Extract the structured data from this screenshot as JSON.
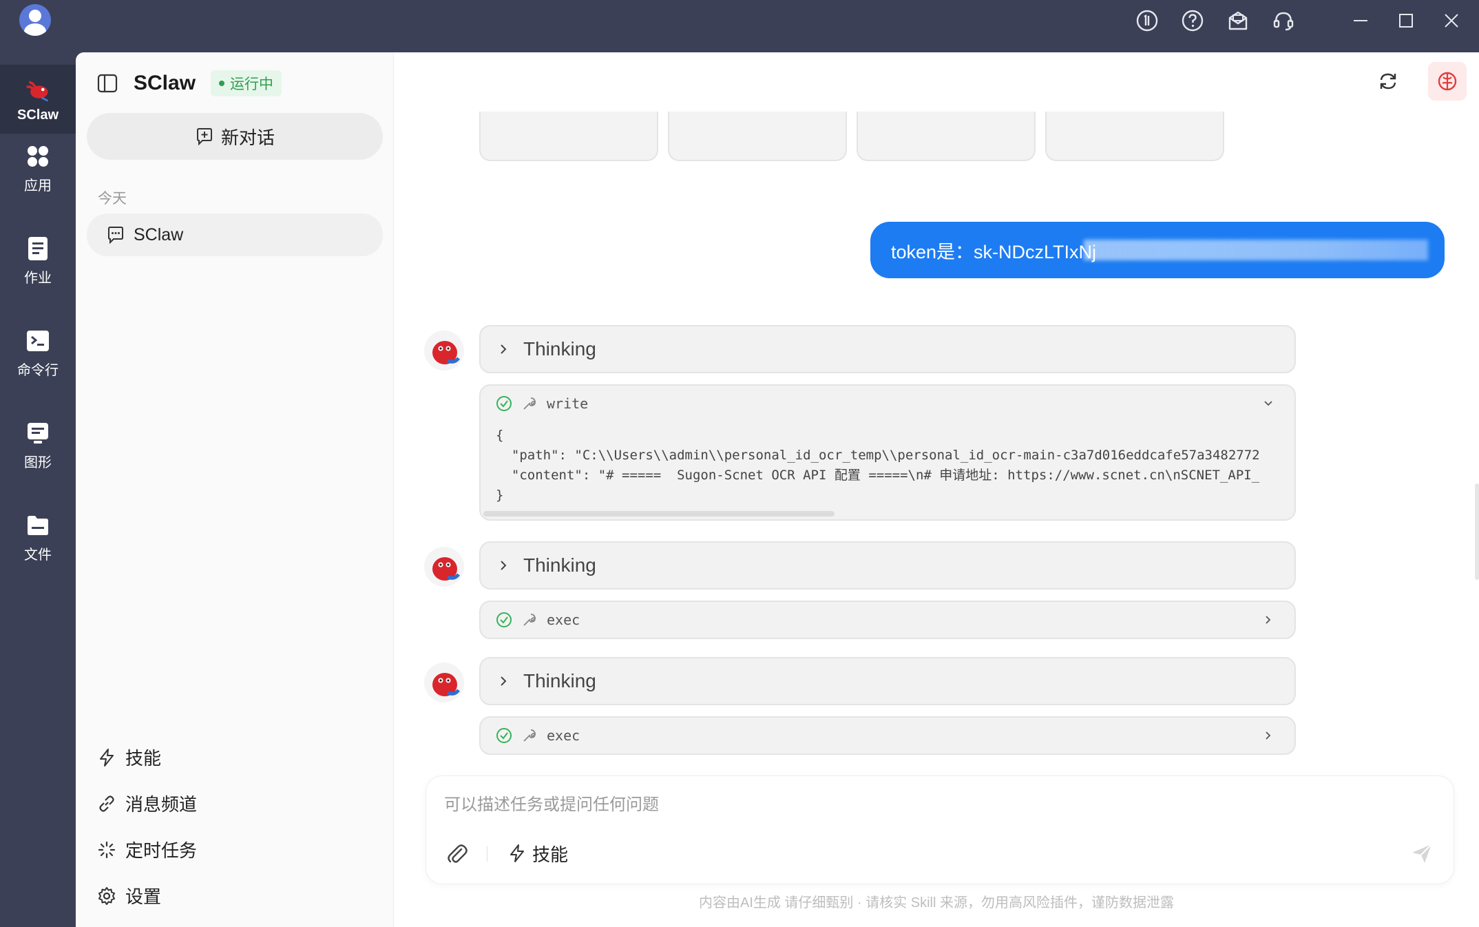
{
  "sidebar_app": {
    "title": "SClaw",
    "status": "运行中",
    "new_chat": "新对话",
    "section_today": "今天",
    "conversations": [
      {
        "label": "SClaw"
      }
    ],
    "bottom_links": [
      {
        "label": "技能",
        "icon": "lightning-icon"
      },
      {
        "label": "消息频道",
        "icon": "link-icon"
      },
      {
        "label": "定时任务",
        "icon": "spinner-icon"
      },
      {
        "label": "设置",
        "icon": "gear-icon"
      }
    ]
  },
  "leftnav": {
    "items": [
      {
        "label": "SClaw",
        "icon": "sclaw-logo-icon",
        "active": true
      },
      {
        "label": "应用",
        "icon": "apps-grid-icon"
      },
      {
        "label": "作业",
        "icon": "document-icon"
      },
      {
        "label": "命令行",
        "icon": "terminal-icon"
      },
      {
        "label": "图形",
        "icon": "graphics-icon"
      },
      {
        "label": "文件",
        "icon": "folder-icon"
      }
    ]
  },
  "titlebar": {
    "icons": [
      "info-circle-icon",
      "help-icon",
      "mail-icon",
      "headset-icon",
      "minimize-icon",
      "maximize-icon",
      "close-icon"
    ]
  },
  "chat": {
    "user_message": "token是：sk-NDczLTIxNj",
    "blocks": [
      {
        "thinking": "Thinking",
        "tool": {
          "name": "write",
          "expanded": true,
          "body_lines": [
            "{",
            "  \"path\": \"C:\\\\Users\\\\admin\\\\personal_id_ocr_temp\\\\personal_id_ocr-main-c3a7d016eddcafe57a3482772",
            "  \"content\": \"# =====  Sugon-Scnet OCR API 配置 =====\\n# 申请地址: https://www.scnet.cn\\nSCNET_API_",
            "}"
          ]
        }
      },
      {
        "thinking": "Thinking",
        "tool": {
          "name": "exec",
          "expanded": false
        }
      },
      {
        "thinking": "Thinking",
        "tool": {
          "name": "exec",
          "expanded": false
        }
      }
    ]
  },
  "composer": {
    "placeholder": "可以描述任务或提问任何问题",
    "skill_label": "技能"
  },
  "disclaimer": "内容由AI生成 请仔细甄别 · 请核实 Skill 来源，勿用高风险插件，谨防数据泄露",
  "colors": {
    "accent": "#1d7cf2",
    "nav_bg": "#3b4056",
    "status_green": "#2f9e4f"
  }
}
